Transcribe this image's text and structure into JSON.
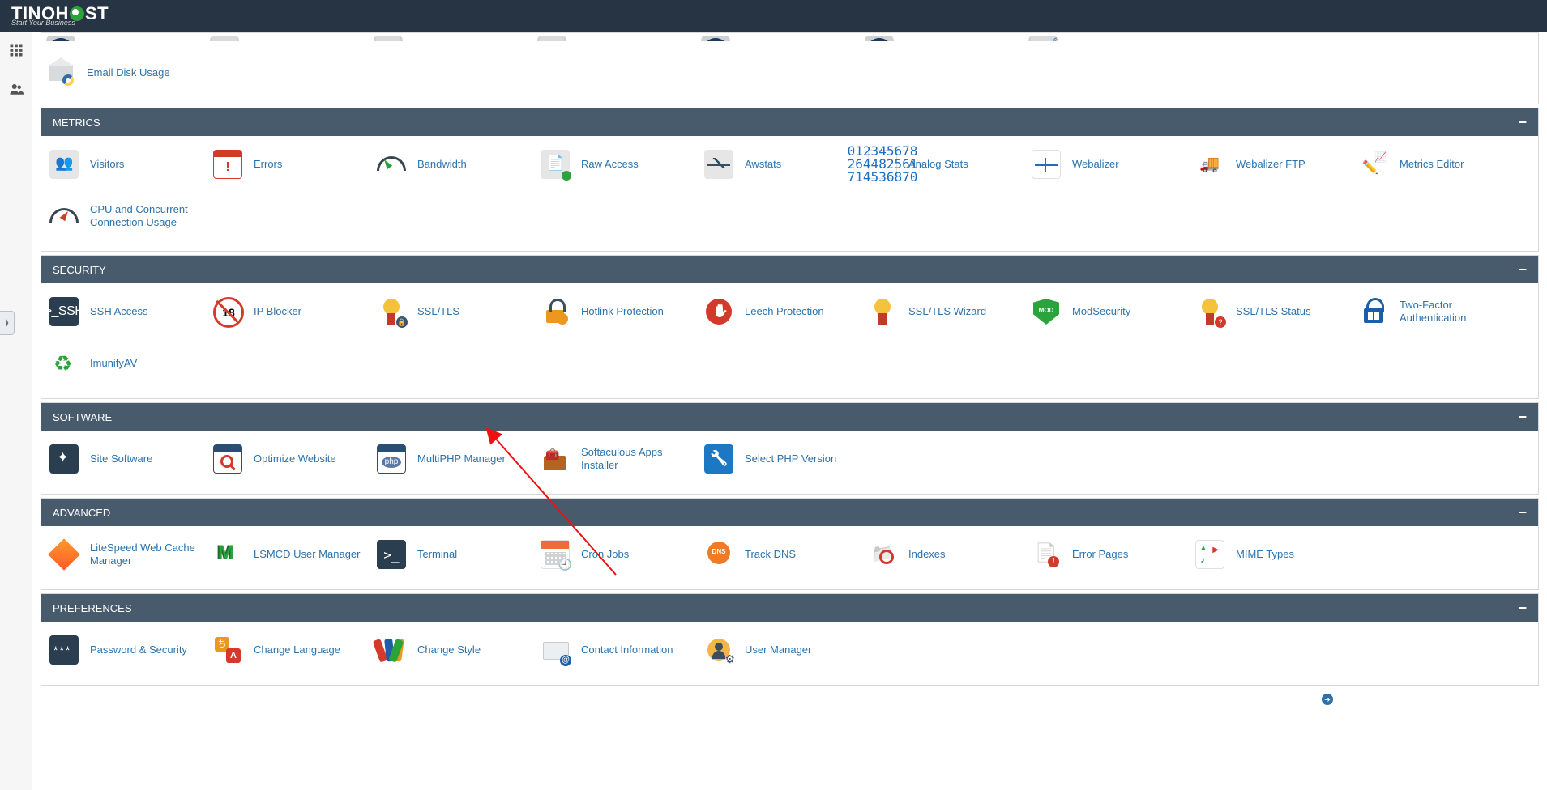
{
  "header": {
    "brand_main": "TINOH",
    "brand_suffix": "ST",
    "brand_sub": "Start Your Business"
  },
  "top_row": {
    "email_disk_usage": "Email Disk Usage"
  },
  "sections": {
    "metrics": {
      "title": "METRICS",
      "items": {
        "visitors": "Visitors",
        "errors": "Errors",
        "bandwidth": "Bandwidth",
        "raw_access": "Raw Access",
        "awstats": "Awstats",
        "analog_stats": "Analog Stats",
        "webalizer": "Webalizer",
        "webalizer_ftp": "Webalizer FTP",
        "metrics_editor": "Metrics Editor",
        "cpu_concurrent": "CPU and Concurrent Connection Usage"
      }
    },
    "security": {
      "title": "SECURITY",
      "items": {
        "ssh_access": "SSH Access",
        "ip_blocker": "IP Blocker",
        "ssl_tls": "SSL/TLS",
        "hotlink": "Hotlink Protection",
        "leech": "Leech Protection",
        "ssl_wizard": "SSL/TLS Wizard",
        "modsecurity": "ModSecurity",
        "ssl_status": "SSL/TLS Status",
        "two_factor": "Two-Factor Authentication",
        "imunifyav": "ImunifyAV"
      }
    },
    "software": {
      "title": "SOFTWARE",
      "items": {
        "site_software": "Site Software",
        "optimize_website": "Optimize Website",
        "multiphp": "MultiPHP Manager",
        "softaculous": "Softaculous Apps Installer",
        "select_php": "Select PHP Version"
      }
    },
    "advanced": {
      "title": "ADVANCED",
      "items": {
        "litespeed": "LiteSpeed Web Cache Manager",
        "lsmcd": "LSMCD User Manager",
        "terminal": "Terminal",
        "cron": "Cron Jobs",
        "track_dns": "Track DNS",
        "indexes": "Indexes",
        "error_pages": "Error Pages",
        "mime": "MIME Types"
      }
    },
    "preferences": {
      "title": "PREFERENCES",
      "items": {
        "password_security": "Password & Security",
        "change_language": "Change Language",
        "change_style": "Change Style",
        "contact_info": "Contact Information",
        "user_manager": "User Manager"
      }
    }
  },
  "analog_mini_text": "012345678\n264482561\n714536870"
}
